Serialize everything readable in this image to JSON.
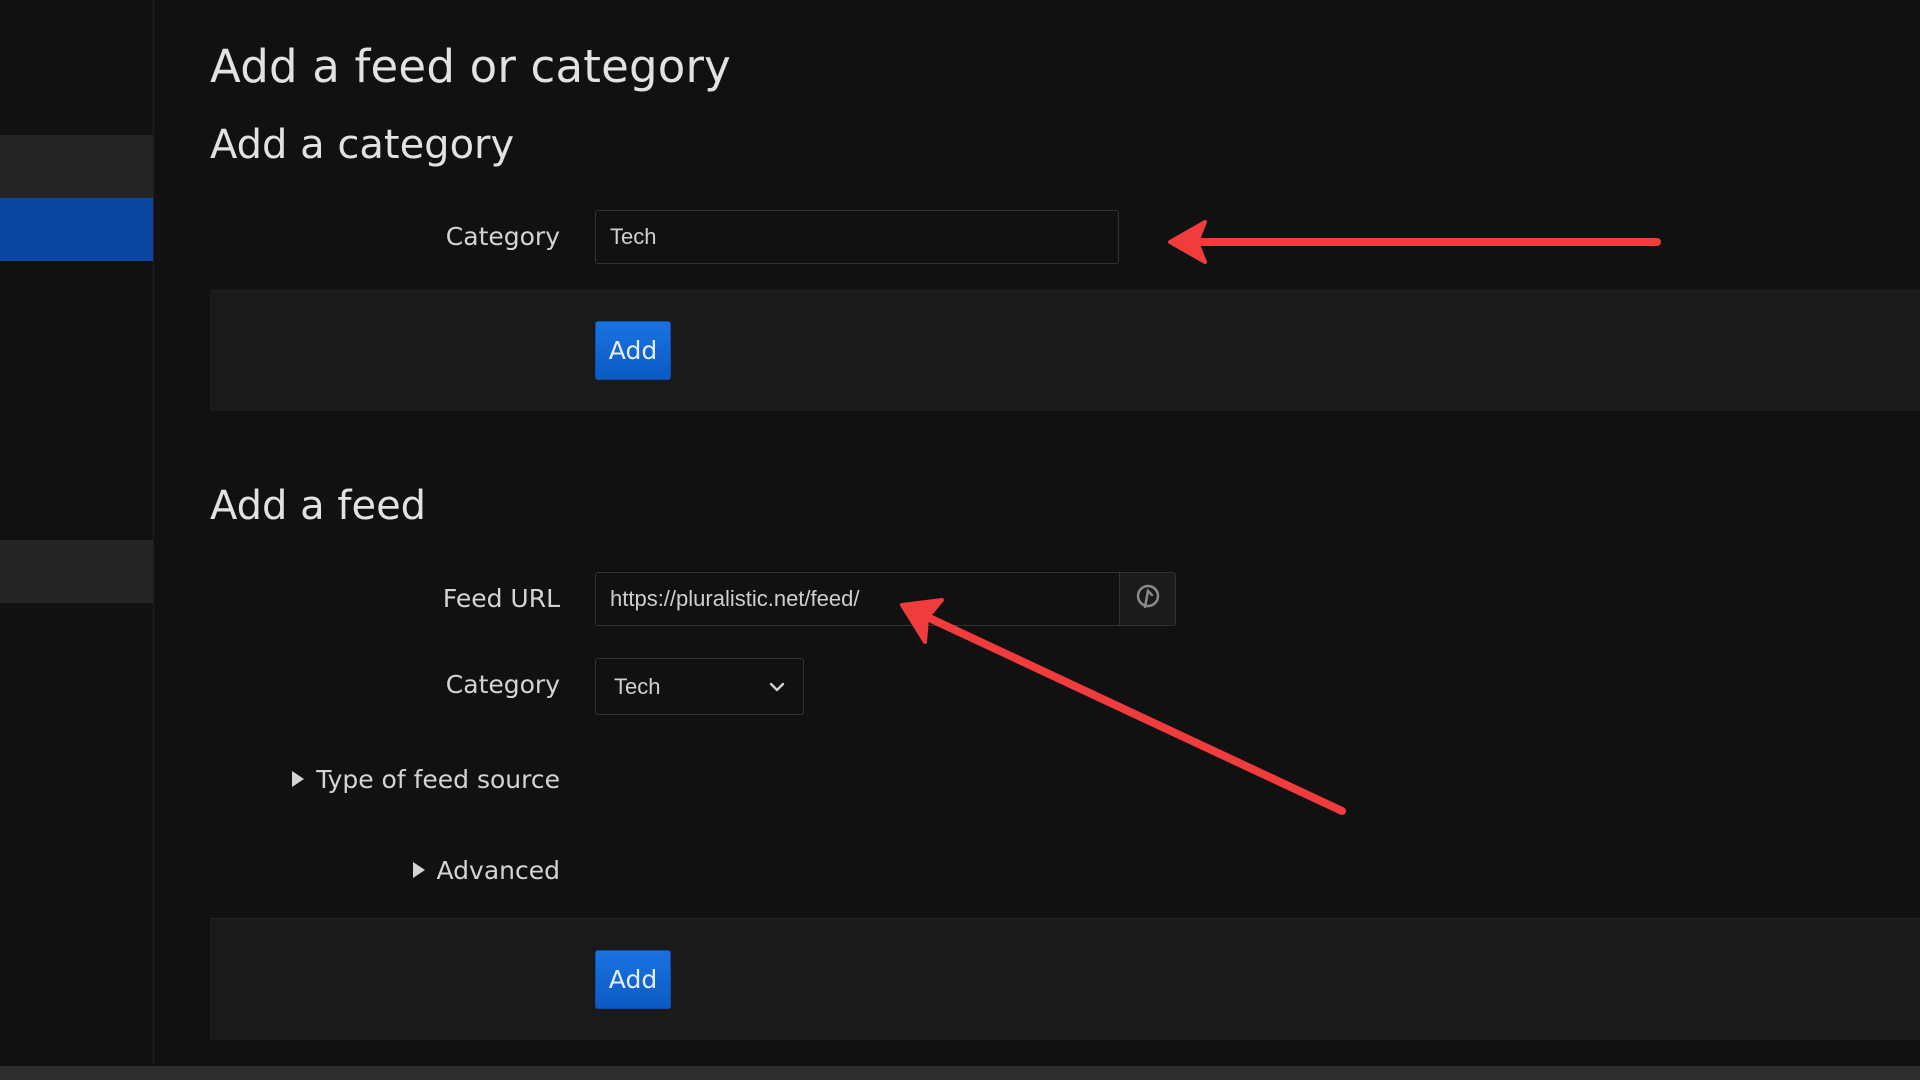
{
  "page": {
    "title": "Add a feed or category"
  },
  "category_section": {
    "heading": "Add a category",
    "label": "Category",
    "value": "Tech",
    "add_label": "Add"
  },
  "feed_section": {
    "heading": "Add a feed",
    "url_label": "Feed URL",
    "url_value": "https://pluralistic.net/feed/",
    "category_label": "Category",
    "category_selected": "Tech",
    "type_label": "Type of feed source",
    "advanced_label": "Advanced",
    "add_label": "Add"
  },
  "colors": {
    "background": "#111111",
    "accent": "#0b46a3",
    "button": "#1a73e0",
    "annotation": "#f03c3c"
  },
  "icons": {
    "url_action": "pin-icon",
    "select_chevron": "chevron-down-icon",
    "disclosure": "triangle-right-icon"
  }
}
